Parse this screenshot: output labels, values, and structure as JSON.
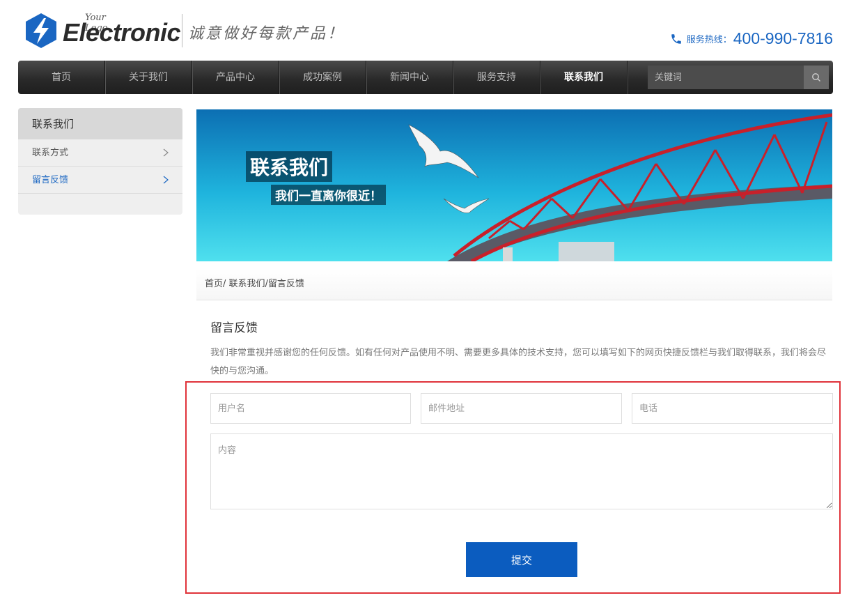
{
  "header": {
    "logo_small": "Your Logo",
    "logo_big": "Electronic",
    "slogan": "诚意做好每款产品！",
    "hotline_label": "服务热线：",
    "hotline_number": "400-990-7816",
    "icon_logo": "lightning-hexagon-icon",
    "icon_phone": "phone-icon"
  },
  "nav": {
    "items": [
      {
        "label": "首页"
      },
      {
        "label": "关于我们"
      },
      {
        "label": "产品中心"
      },
      {
        "label": "成功案例"
      },
      {
        "label": "新闻中心"
      },
      {
        "label": "服务支持"
      },
      {
        "label": "联系我们",
        "active": true
      }
    ],
    "search_placeholder": "关键词",
    "search_icon": "search-icon"
  },
  "sidebar": {
    "title": "联系我们",
    "items": [
      {
        "label": "联系方式"
      },
      {
        "label": "留言反馈",
        "active": true
      }
    ]
  },
  "banner": {
    "title": "联系我们",
    "subtitle": "我们一直离你很近！"
  },
  "breadcrumb": "首页/ 联系我们/留言反馈",
  "main": {
    "title": "留言反馈",
    "intro": "我们非常重视并感谢您的任何反馈。如有任何对产品使用不明、需要更多具体的技术支持，您可以填写如下的网页快捷反馈栏与我们取得联系，我们将会尽快的与您沟通。"
  },
  "form": {
    "username_placeholder": "用户名",
    "email_placeholder": "邮件地址",
    "phone_placeholder": "电话",
    "content_placeholder": "内容",
    "submit_label": "提交"
  },
  "colors": {
    "accent": "#0b5cbf",
    "link": "#1a66c2",
    "highlight_border": "#e0333a",
    "nav_bg": "#2a2a2a"
  }
}
